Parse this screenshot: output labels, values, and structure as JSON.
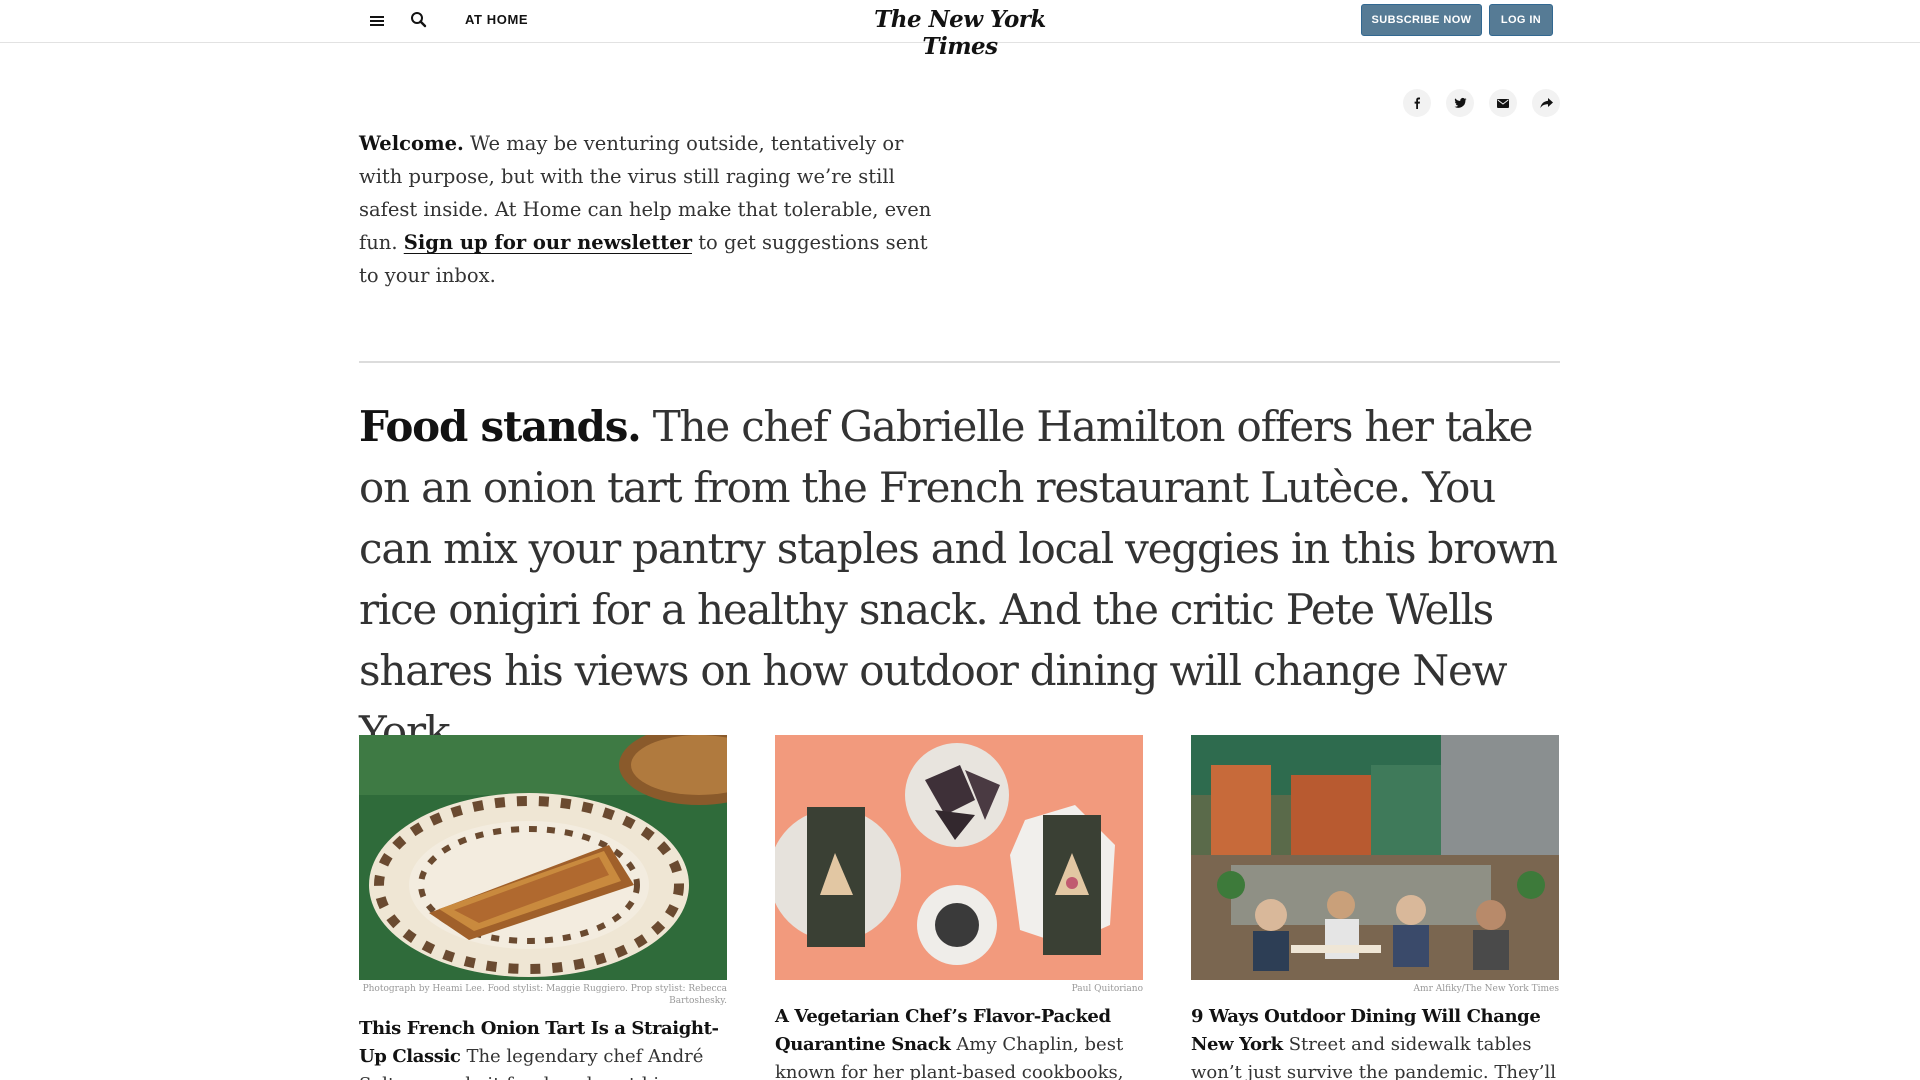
{
  "header": {
    "section": "AT HOME",
    "logo": "The New York Times",
    "subscribe_label": "SUBSCRIBE NOW",
    "login_label": "LOG IN"
  },
  "share_icons": [
    "facebook-icon",
    "twitter-icon",
    "email-icon",
    "share-icon"
  ],
  "welcome": {
    "lead": "Welcome.",
    "body": " We may be venturing outside, tentatively or with purpose, but with the virus still raging we’re still safest inside. At Home can help make that tolerable, even fun. ",
    "link": "Sign up for our newsletter",
    "tail": " to get suggestions sent to your inbox."
  },
  "lede": {
    "lead": "Food stands.",
    "body": " The chef Gabrielle Hamilton offers her take on an onion tart from the French restaurant Lutèce. You can mix your pantry staples and local veggies in this brown rice onigiri for a healthy snack. And the critic Pete Wells shares his views on how outdoor dining will change New York."
  },
  "cards": [
    {
      "credit": "Photograph by Heami Lee. Food stylist: Maggie Ruggiero. Prop stylist: Rebecca Bartoshesky.",
      "headline": "This French Onion Tart Is a Straight-Up Classic",
      "summary": "The legendary chef André Soltner made it for decades at his Manhattan"
    },
    {
      "credit": "Paul Quitoriano",
      "headline": "A Vegetarian Chef’s Flavor-Packed Quarantine Snack",
      "summary": "Amy Chaplin, best known for her plant-based cookbooks,"
    },
    {
      "credit": "Amr Alfiky/The New York Times",
      "headline": "9 Ways Outdoor Dining Will Change New York",
      "summary": "Street and sidewalk tables won’t just survive the pandemic. They’ll make the"
    }
  ],
  "colors": {
    "subscribe_bg": "#567b95",
    "rule": "#dcdcdc",
    "text": "#333333"
  }
}
